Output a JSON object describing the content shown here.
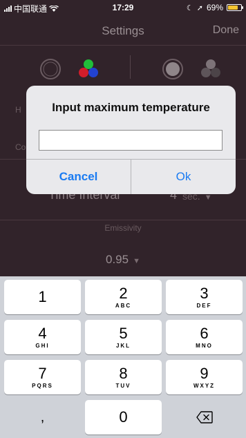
{
  "status_bar": {
    "carrier": "中国联通",
    "time": "17:29",
    "battery": "69%",
    "icons": [
      "signal-icon",
      "wifi-icon",
      "moon-icon",
      "location-icon",
      "battery-icon"
    ]
  },
  "nav": {
    "title": "Settings",
    "done": "Done"
  },
  "background": {
    "row_h_label": "H",
    "row_c_label": "Co",
    "time_interval_label": "Time Interval",
    "time_interval_value": "4",
    "time_interval_unit": "sec.",
    "emissivity_label": "Emissivity",
    "emissivity_value": "0.95"
  },
  "alert": {
    "title": "Input maximum temperature",
    "input_value": "",
    "cancel_label": "Cancel",
    "ok_label": "Ok"
  },
  "keypad": {
    "keys": [
      {
        "num": "1",
        "letters": ""
      },
      {
        "num": "2",
        "letters": "ABC"
      },
      {
        "num": "3",
        "letters": "DEF"
      },
      {
        "num": "4",
        "letters": "GHI"
      },
      {
        "num": "5",
        "letters": "JKL"
      },
      {
        "num": "6",
        "letters": "MNO"
      },
      {
        "num": "7",
        "letters": "PQRS"
      },
      {
        "num": "8",
        "letters": "TUV"
      },
      {
        "num": "9",
        "letters": "WXYZ"
      },
      {
        "num": ",",
        "letters": ""
      },
      {
        "num": "0",
        "letters": ""
      }
    ]
  },
  "colors": {
    "accent": "#1a7bf2",
    "battery": "#f4c430",
    "dim_bg": "#31232a"
  }
}
